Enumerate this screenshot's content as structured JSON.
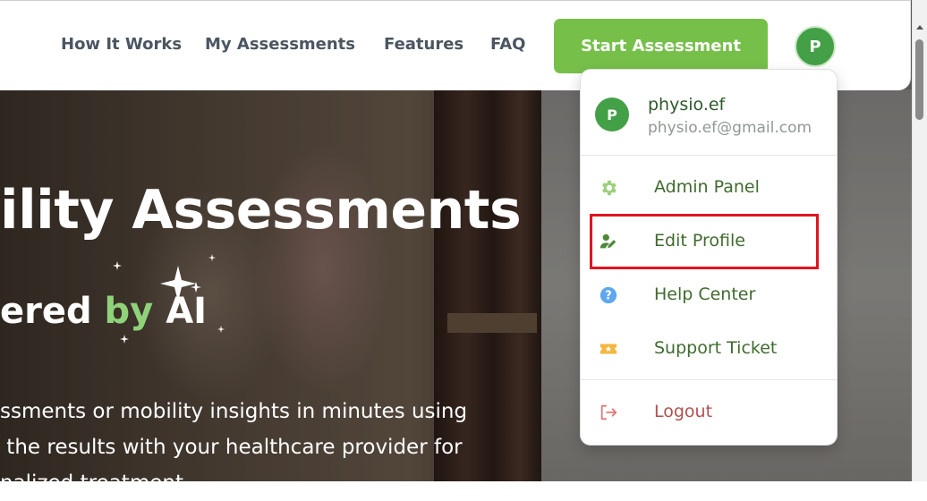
{
  "nav": {
    "links": [
      "How It Works",
      "My Assessments",
      "Features",
      "FAQ"
    ],
    "cta_label": "Start Assessment",
    "avatar_initial": "P"
  },
  "hero": {
    "title": "ility Assessments",
    "subtitle_prefix": "ered ",
    "subtitle_by": "by",
    "subtitle_suffix": " AI",
    "desc_lines": [
      "ssments or mobility insights in minutes using",
      " the results with your healthcare provider for",
      "nalized treatment"
    ]
  },
  "dropdown": {
    "user": {
      "initial": "P",
      "name": "physio.ef",
      "email": "physio.ef@gmail.com"
    },
    "items": [
      {
        "label": "Admin Panel",
        "icon": "gear-icon"
      },
      {
        "label": "Edit Profile",
        "icon": "user-edit-icon"
      },
      {
        "label": "Help Center",
        "icon": "question-circle-icon"
      },
      {
        "label": "Support Ticket",
        "icon": "ticket-icon"
      }
    ],
    "logout_label": "Logout",
    "logout_icon": "logout-icon"
  },
  "colors": {
    "accent_green": "#76c04a",
    "avatar_green": "#43a047",
    "item_text": "#3f6b2e",
    "logout_text": "#b25050",
    "highlight_red": "#e0141f"
  }
}
